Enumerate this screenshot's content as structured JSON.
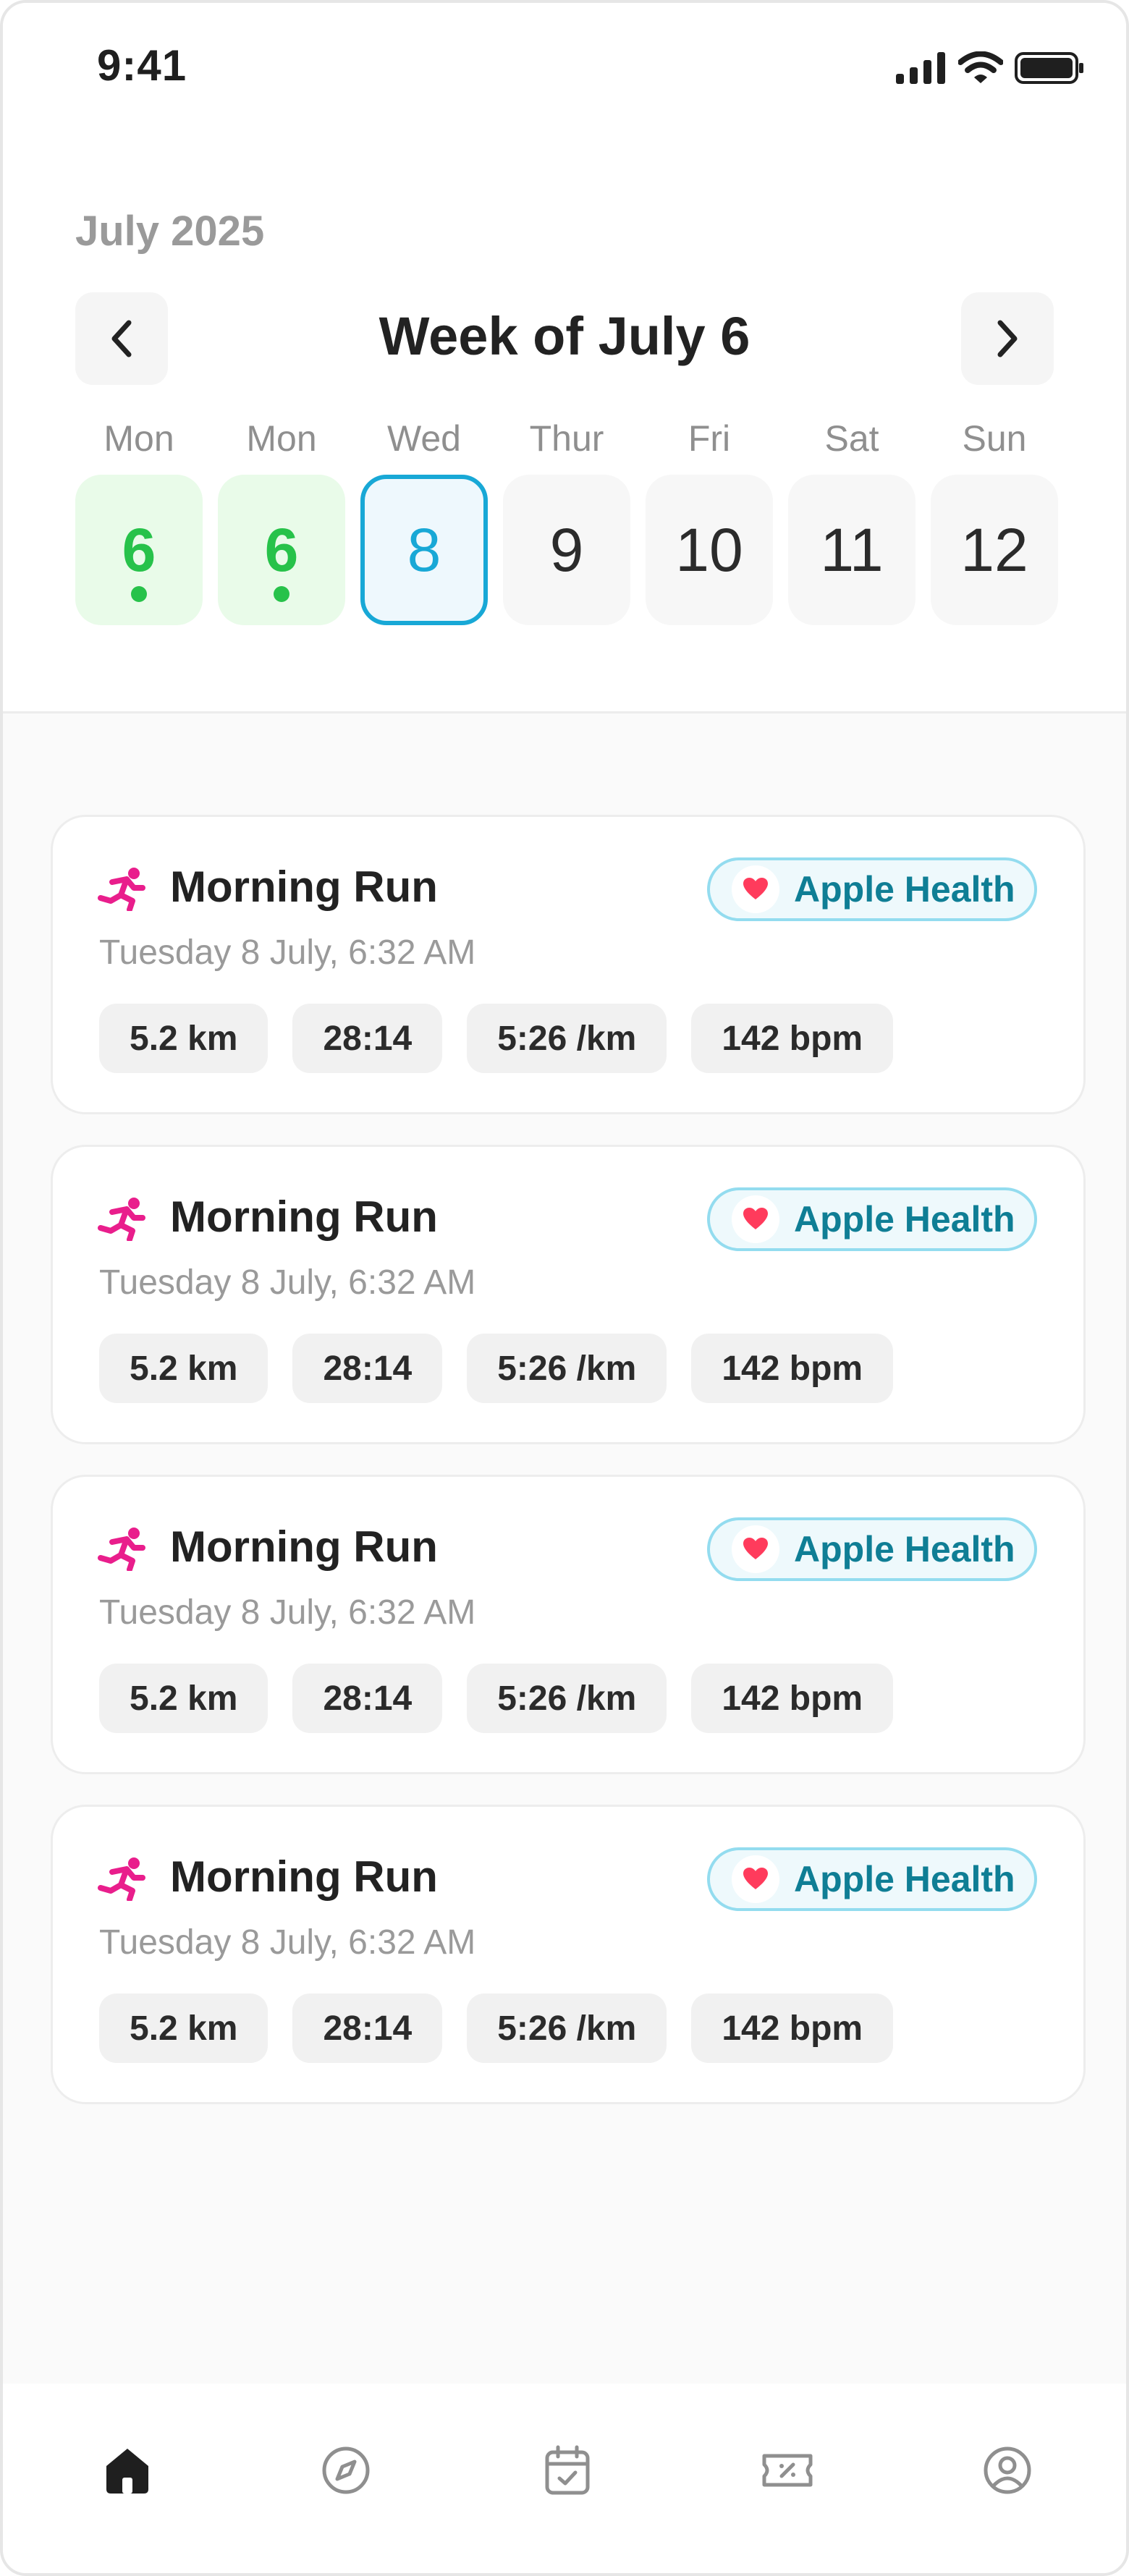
{
  "status_bar": {
    "time": "9:41"
  },
  "header": {
    "month": "July 2025",
    "week_title": "Week of July 6"
  },
  "week": [
    {
      "name": "Mon",
      "date": "6",
      "state": "done"
    },
    {
      "name": "Mon",
      "date": "6",
      "state": "done"
    },
    {
      "name": "Wed",
      "date": "8",
      "state": "selected"
    },
    {
      "name": "Thur",
      "date": "9",
      "state": "default"
    },
    {
      "name": "Fri",
      "date": "10",
      "state": "default"
    },
    {
      "name": "Sat",
      "date": "11",
      "state": "default"
    },
    {
      "name": "Sun",
      "date": "12",
      "state": "default"
    }
  ],
  "workouts": [
    {
      "title": "Morning Run",
      "datetime": "Tuesday 8 July, 6:32 AM",
      "source": "Apple Health",
      "distance": "5.2 km",
      "duration": "28:14",
      "pace": "5:26 /km",
      "heart_rate": "142 bpm"
    },
    {
      "title": "Morning Run",
      "datetime": "Tuesday 8 July, 6:32 AM",
      "source": "Apple Health",
      "distance": "5.2 km",
      "duration": "28:14",
      "pace": "5:26 /km",
      "heart_rate": "142 bpm"
    },
    {
      "title": "Morning Run",
      "datetime": "Tuesday 8 July, 6:32 AM",
      "source": "Apple Health",
      "distance": "5.2 km",
      "duration": "28:14",
      "pace": "5:26 /km",
      "heart_rate": "142 bpm"
    },
    {
      "title": "Morning Run",
      "datetime": "Tuesday 8 July, 6:32 AM",
      "source": "Apple Health",
      "distance": "5.2 km",
      "duration": "28:14",
      "pace": "5:26 /km",
      "heart_rate": "142 bpm"
    }
  ],
  "bottom_nav": [
    {
      "icon": "home-icon",
      "active": true
    },
    {
      "icon": "compass-icon",
      "active": false
    },
    {
      "icon": "calendar-check-icon",
      "active": false
    },
    {
      "icon": "ticket-icon",
      "active": false
    },
    {
      "icon": "profile-icon",
      "active": false
    }
  ],
  "colors": {
    "done": "#27c24a",
    "selected": "#18a8d6",
    "run_icon": "#e91e8c",
    "badge_text": "#0f7e95",
    "heart": "#ff3b5c"
  }
}
